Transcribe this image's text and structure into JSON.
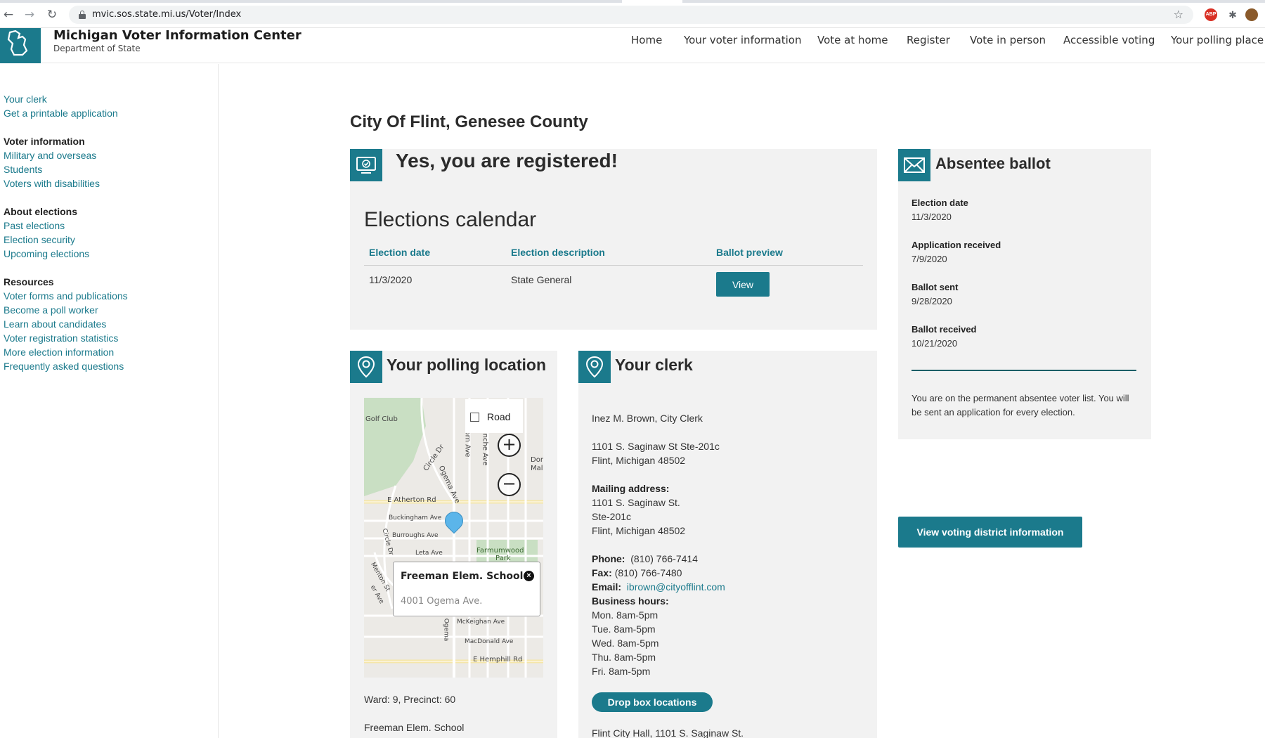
{
  "browser": {
    "url": "mvic.sos.state.mi.us/Voter/Index",
    "back_icon": "arrow-left-icon",
    "forward_icon": "arrow-right-icon",
    "reload_icon": "reload-icon"
  },
  "header": {
    "title": "Michigan Voter Information Center",
    "subtitle": "Department of State",
    "nav": [
      "Home",
      "Your voter information",
      "Vote at home",
      "Register",
      "Vote in person",
      "Accessible voting",
      "Your polling place"
    ]
  },
  "sidebar": {
    "top_links": [
      "Your clerk",
      "Get a printable application"
    ],
    "sections": [
      {
        "heading": "Voter information",
        "links": [
          "Military and overseas",
          "Students",
          "Voters with disabilities"
        ]
      },
      {
        "heading": "About elections",
        "links": [
          "Past elections",
          "Election security",
          "Upcoming elections"
        ]
      },
      {
        "heading": "Resources",
        "links": [
          "Voter forms and publications",
          "Become a poll worker",
          "Learn about candidates",
          "Voter registration statistics",
          "More election information",
          "Frequently asked questions"
        ]
      }
    ]
  },
  "main": {
    "page_title": "City Of Flint, Genesee County",
    "registration": {
      "title": "Yes, you are registered!",
      "calendar_title": "Elections calendar",
      "columns": [
        "Election date",
        "Election description",
        "Ballot preview"
      ],
      "rows": [
        {
          "date": "11/3/2020",
          "description": "State General",
          "action": "View"
        }
      ]
    },
    "polling": {
      "title": "Your polling location",
      "map": {
        "type_label": "Road",
        "place_name": "Freeman Elem. School",
        "place_address": "4001 Ogema Ave.",
        "labels": [
          "Golf Club",
          "Circle Dr",
          "Ogema Ave",
          "orn Ave",
          "anche Ave",
          "Dor",
          "Mal",
          "E Atherton Rd",
          "Buckingham Ave",
          "Burroughs Ave",
          "Leta Ave",
          "Farmumwood",
          "Park",
          "Circle Dr",
          "Menton St",
          "er Ave",
          "McKeighan Ave",
          "MacDonald Ave",
          "E Hemphill Rd",
          "Ogema"
        ]
      },
      "ward_precinct": "Ward: 9, Precinct: 60",
      "location_name": "Freeman Elem. School"
    },
    "clerk": {
      "title": "Your clerk",
      "name": "Inez M. Brown, City Clerk",
      "address_line1": "1101 S. Saginaw St Ste-201c",
      "address_line2": "Flint, Michigan 48502",
      "mailing_label": "Mailing address:",
      "mailing_lines": [
        "1101 S. Saginaw St.",
        "Ste-201c",
        "Flint, Michigan 48502"
      ],
      "phone_label": "Phone:",
      "phone": "(810) 766-7414",
      "fax_label": "Fax:",
      "fax": "(810) 766-7480",
      "email_label": "Email:",
      "email": "ibrown@cityofflint.com",
      "hours_label": "Business hours:",
      "hours": [
        "Mon. 8am-5pm",
        "Tue. 8am-5pm",
        "Wed. 8am-5pm",
        "Thu. 8am-5pm",
        "Fri. 8am-5pm"
      ],
      "dropbox_button": "Drop box locations",
      "dropbox_first": "Flint City Hall, 1101 S. Saginaw St."
    },
    "absentee": {
      "title": "Absentee ballot",
      "fields": [
        {
          "label": "Election date",
          "value": "11/3/2020"
        },
        {
          "label": "Application received",
          "value": "7/9/2020"
        },
        {
          "label": "Ballot sent",
          "value": "9/28/2020"
        },
        {
          "label": "Ballot received",
          "value": "10/21/2020"
        }
      ],
      "note": "You are on the permanent absentee voter list. You will be sent an application for every election.",
      "district_button": "View voting district information"
    }
  },
  "colors": {
    "accent": "#1b7a8c",
    "card_bg": "#f2f2f2",
    "rule": "#1b5e66"
  }
}
